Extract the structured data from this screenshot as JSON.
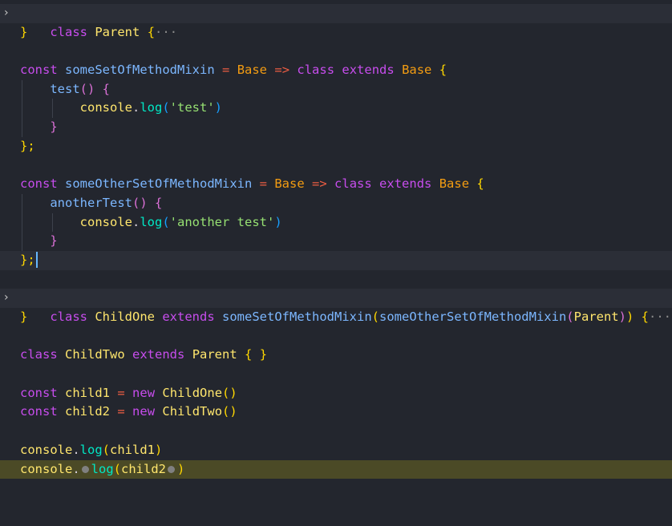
{
  "code": {
    "l1_kw": "class",
    "l1_name": "Parent",
    "l1_brace": "{",
    "l1_ellipsis": "···",
    "l2_brace": "}",
    "l4_const": "const",
    "l4_name": "someSetOfMethodMixin",
    "l4_eq": "=",
    "l4_base": "Base",
    "l4_arrow": "=>",
    "l4_class": "class",
    "l4_extends": "extends",
    "l4_base2": "Base",
    "l4_brace": "{",
    "l5_method": "test",
    "l5_parens": "()",
    "l5_brace": "{",
    "l6_console": "console",
    "l6_dot": ".",
    "l6_log": "log",
    "l6_open": "(",
    "l6_str": "'test'",
    "l6_close": ")",
    "l7_brace": "}",
    "l8_end": "};",
    "l10_const": "const",
    "l10_name": "someOtherSetOfMethodMixin",
    "l10_eq": "=",
    "l10_base": "Base",
    "l10_arrow": "=>",
    "l10_class": "class",
    "l10_extends": "extends",
    "l10_base2": "Base",
    "l10_brace": "{",
    "l11_method": "anotherTest",
    "l11_parens": "()",
    "l11_brace": "{",
    "l12_console": "console",
    "l12_dot": ".",
    "l12_log": "log",
    "l12_open": "(",
    "l12_str": "'another test'",
    "l12_close": ")",
    "l13_brace": "}",
    "l14_end": "};",
    "l16_kw": "class",
    "l16_name": "ChildOne",
    "l16_extends": "extends",
    "l16_mixin1": "someSetOfMethodMixin",
    "l16_open1": "(",
    "l16_mixin2": "someOtherSetOfMethodMixin",
    "l16_open2": "(",
    "l16_parent": "Parent",
    "l16_close2": ")",
    "l16_close1": ")",
    "l16_brace": "{",
    "l16_ellipsis": "···",
    "l17_brace": "}",
    "l19_kw": "class",
    "l19_name": "ChildTwo",
    "l19_extends": "extends",
    "l19_parent": "Parent",
    "l19_open": "{",
    "l19_close": "}",
    "l21_const": "const",
    "l21_name": "child1",
    "l21_eq": "=",
    "l21_new": "new",
    "l21_cls": "ChildOne",
    "l21_parens": "()",
    "l22_const": "const",
    "l22_name": "child2",
    "l22_eq": "=",
    "l22_new": "new",
    "l22_cls": "ChildTwo",
    "l22_parens": "()",
    "l24_console": "console",
    "l24_dot": ".",
    "l24_log": "log",
    "l24_open": "(",
    "l24_arg": "child1",
    "l24_close": ")",
    "l25_console": "console",
    "l25_dot": ".",
    "l25_log": "log",
    "l25_open": "(",
    "l25_arg": "child2",
    "l25_close": ")"
  },
  "fold_glyph": "›",
  "colors": {
    "background": "#23262e",
    "debug_highlight": "#4b4a26",
    "keyword": "#c74ded",
    "string": "#96e072",
    "function": "#00e8c6"
  }
}
